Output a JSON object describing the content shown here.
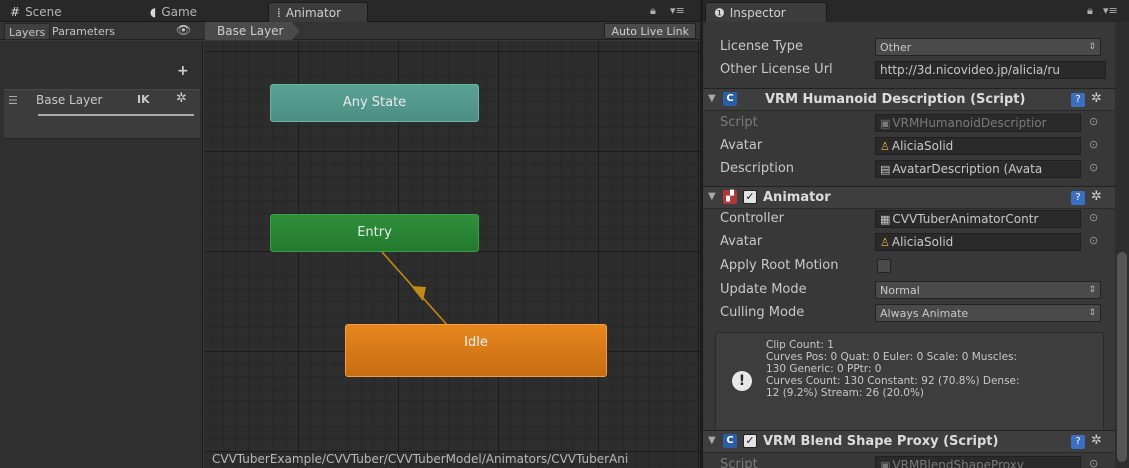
{
  "left_tabs": {
    "scene": "Scene",
    "game": "Game",
    "animator": "Animator"
  },
  "animator": {
    "layers_tab": "Layers",
    "parameters_tab": "Parameters",
    "breadcrumb": "Base Layer",
    "auto_live_link": "Auto Live Link",
    "add_layer": "+",
    "layer": {
      "name": "Base Layer",
      "ik_label": "IK"
    },
    "states": {
      "any_state": "Any State",
      "entry": "Entry",
      "idle": "Idle"
    },
    "path": "CVVTuberExample/CVVTuber/CVVTuberModel/Animators/CVVTuberAni"
  },
  "inspector": {
    "tab": "Inspector",
    "license_type_label": "License Type",
    "license_type_value": "Other",
    "other_license_url_label": "Other License Url",
    "other_license_url_value": "http://3d.nicovideo.jp/alicia/ru",
    "humanoid_component": {
      "title": "VRM Humanoid Description (Script)",
      "script_label": "Script",
      "script_value": "VRMHumanoidDescriptior",
      "avatar_label": "Avatar",
      "avatar_value": "AliciaSolid",
      "description_label": "Description",
      "description_value": "AvatarDescription (Avata"
    },
    "animator_component": {
      "title": "Animator",
      "controller_label": "Controller",
      "controller_value": "CVVTuberAnimatorContr",
      "avatar_label": "Avatar",
      "avatar_value": "AliciaSolid",
      "apply_root_motion_label": "Apply Root Motion",
      "update_mode_label": "Update Mode",
      "update_mode_value": "Normal",
      "culling_mode_label": "Culling Mode",
      "culling_mode_value": "Always Animate",
      "info_text": "Clip Count: 1\nCurves Pos: 0 Quat: 0 Euler: 0 Scale: 0 Muscles:\n130 Generic: 0 PPtr: 0\nCurves Count: 130 Constant: 92 (70.8%) Dense:\n12 (9.2%) Stream: 26 (20.0%)"
    },
    "blend_shape_component": {
      "title": "VRM Blend Shape Proxy (Script)",
      "script_label": "Script",
      "script_value": "VRMBlendShapeProxy"
    }
  },
  "colors": {
    "any_state": "#4c8f83",
    "entry": "#237a2e",
    "idle": "#c76d12",
    "transition_arrow": "#c08a14"
  }
}
